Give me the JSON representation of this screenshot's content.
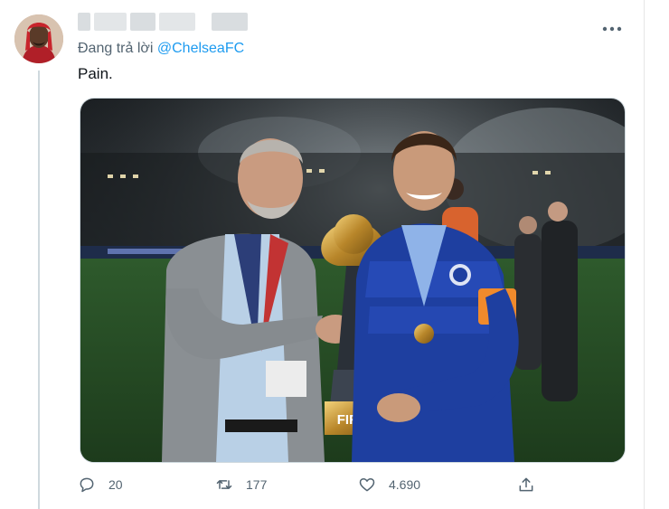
{
  "tweet": {
    "replying_prefix": "Đang trả lời",
    "replying_to": "@ChelseaFC",
    "text": "Pain."
  },
  "media": {
    "trophy_text": "FIFA"
  },
  "actions": {
    "replies": "20",
    "retweets": "177",
    "likes": "4.690"
  },
  "icons": {
    "more": "more-horizontal-icon",
    "reply": "comment-icon",
    "retweet": "retweet-icon",
    "like": "heart-icon",
    "share": "share-icon"
  },
  "colors": {
    "link": "#1d9bf0",
    "muted": "#536471",
    "thread_line": "#cfd9de"
  }
}
